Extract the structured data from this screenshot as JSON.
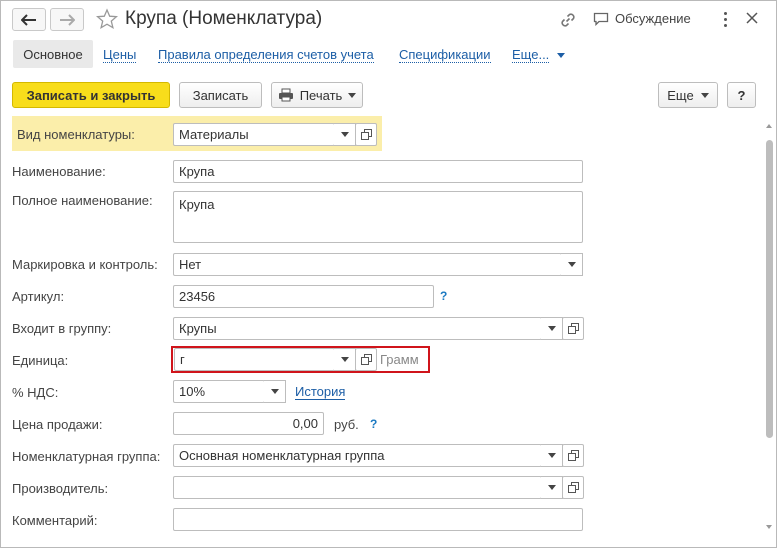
{
  "window": {
    "title": "Крупа (Номенклатура)",
    "discussion_label": "Обсуждение",
    "icons": [
      "back-arrow-icon",
      "forward-arrow-icon",
      "star-icon",
      "link-icon",
      "chat-icon",
      "more-vert-icon",
      "close-icon"
    ]
  },
  "tabs": {
    "active": "Основное",
    "links": [
      "Цены",
      "Правила определения счетов учета",
      "Спецификации"
    ],
    "more": "Еще..."
  },
  "toolbar": {
    "save_close": "Записать и закрыть",
    "save": "Записать",
    "print": "Печать",
    "more": "Еще",
    "help": "?"
  },
  "form": {
    "vid": {
      "label": "Вид номенклатуры:",
      "value": "Материалы"
    },
    "name": {
      "label": "Наименование:",
      "value": "Крупа"
    },
    "full_name": {
      "label": "Полное наименование:",
      "value": "Крупа"
    },
    "marking": {
      "label": "Маркировка и контроль:",
      "value": "Нет"
    },
    "article": {
      "label": "Артикул:",
      "value": "23456",
      "help": "?"
    },
    "group": {
      "label": "Входит в группу:",
      "value": "Крупы"
    },
    "unit": {
      "label": "Единица:",
      "value": "г",
      "unit_name": "Грамм"
    },
    "vat": {
      "label": "% НДС:",
      "value": "10%",
      "history_link": "История"
    },
    "price": {
      "label": "Цена продажи:",
      "value": "0,00",
      "currency": "руб.",
      "help": "?"
    },
    "nom_group": {
      "label": "Номенклатурная группа:",
      "value": "Основная номенклатурная группа"
    },
    "manufacturer": {
      "label": "Производитель:",
      "value": ""
    },
    "comment": {
      "label": "Комментарий:",
      "value": ""
    }
  },
  "colors": {
    "primary_button": "#f8dd1b",
    "highlight_row": "#fbeeaa",
    "link": "#1c5ea6",
    "selection_border": "#d0141b"
  }
}
